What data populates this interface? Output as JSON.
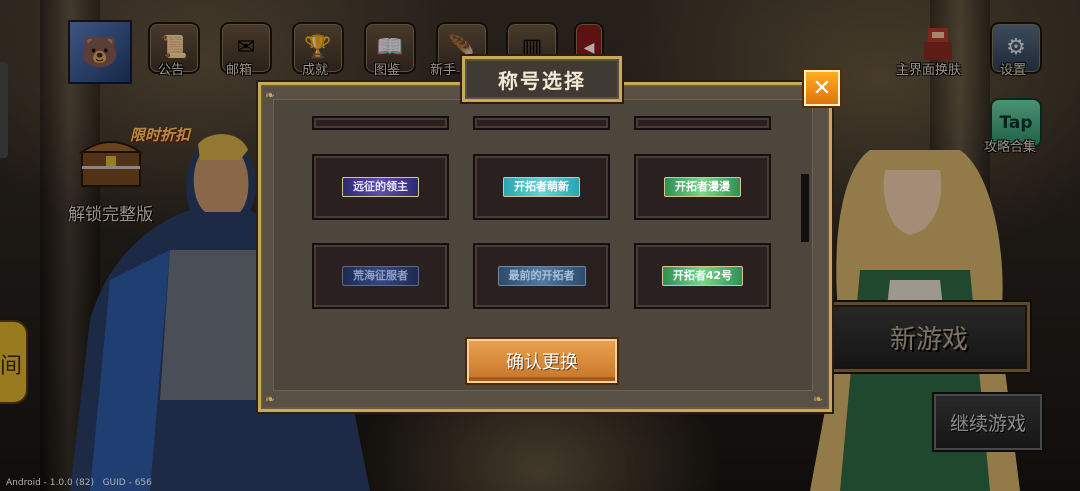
{
  "topbar": {
    "avatar_icon": "polar-bear-avatar",
    "items": [
      {
        "label": "公告",
        "icon": "scroll-icon"
      },
      {
        "label": "邮箱",
        "icon": "mail-icon"
      },
      {
        "label": "成就",
        "icon": "trophy-icon"
      },
      {
        "label": "图鉴",
        "icon": "book-icon"
      },
      {
        "label": "新手",
        "icon": "feather-icon"
      }
    ],
    "skin_label": "主界面换肤",
    "settings_label": "设置"
  },
  "left": {
    "sale_tag": "限时折扣",
    "unlock_label": "解锁完整版",
    "edge_button_glyph": "间"
  },
  "right": {
    "tap_icon_text": "Tap",
    "guide_label": "攻略合集",
    "new_game": "新游戏",
    "continue_game": "继续游戏"
  },
  "version": "Android - 1.0.0 (82)   GUID - 656",
  "modal": {
    "title": "称号选择",
    "close_glyph": "✕",
    "confirm": "确认更换",
    "titles": [
      {
        "text": "远征的领主",
        "style": "purple"
      },
      {
        "text": "开拓者萌新",
        "style": "teal"
      },
      {
        "text": "开拓者漫漫",
        "style": "green"
      },
      {
        "text": "荒海征服者",
        "style": "navy"
      },
      {
        "text": "最前的开拓者",
        "style": "steel"
      },
      {
        "text": "开拓者42号",
        "style": "lime"
      }
    ]
  },
  "colors": {
    "frame_gold": "#c9a85c",
    "confirm_orange": "#e7a24b",
    "close_orange": "#ffad1f"
  }
}
